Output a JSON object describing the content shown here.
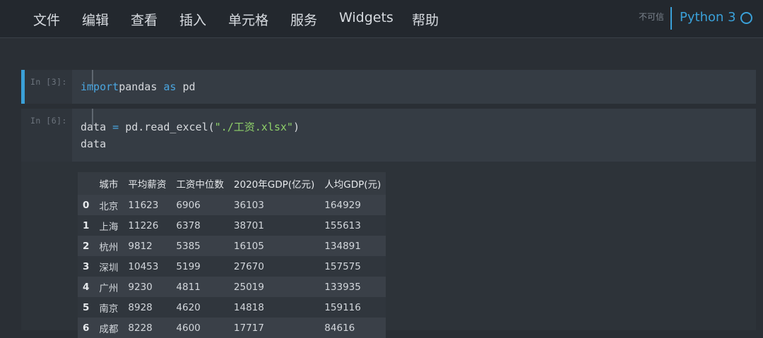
{
  "menu": [
    "文件",
    "编辑",
    "查看",
    "插入",
    "单元格",
    "服务",
    "Widgets",
    "帮助"
  ],
  "trust": "不可信",
  "kernel": "Python 3",
  "cells": [
    {
      "prompt": "In [3]:",
      "lines": [
        {
          "parts": [
            [
              "kw",
              "import"
            ],
            [
              "",
              "pandas"
            ],
            [
              "kw",
              " as"
            ],
            [
              "",
              " pd"
            ]
          ]
        }
      ]
    },
    {
      "prompt": "In [6]:",
      "lines": [
        {
          "parts": [
            [
              "",
              "data "
            ],
            [
              "eq",
              "="
            ],
            [
              "",
              " pd.read_excel("
            ],
            [
              "str",
              "\"./工资.xlsx\""
            ],
            [
              "",
              ")"
            ]
          ]
        },
        {
          "parts": [
            [
              "",
              "data"
            ]
          ]
        }
      ]
    }
  ],
  "table": {
    "columns": [
      "",
      "城市",
      "平均薪资",
      "工资中位数",
      "2020年GDP(亿元)",
      "人均GDP(元)"
    ],
    "rows": [
      [
        "0",
        "北京",
        "11623",
        "6906",
        "36103",
        "164929"
      ],
      [
        "1",
        "上海",
        "11226",
        "6378",
        "38701",
        "155613"
      ],
      [
        "2",
        "杭州",
        "9812",
        "5385",
        "16105",
        "134891"
      ],
      [
        "3",
        "深圳",
        "10453",
        "5199",
        "27670",
        "157575"
      ],
      [
        "4",
        "广州",
        "9230",
        "4811",
        "25019",
        "133935"
      ],
      [
        "5",
        "南京",
        "8928",
        "4620",
        "14818",
        "159116"
      ],
      [
        "6",
        "成都",
        "8228",
        "4600",
        "17717",
        "84616"
      ]
    ]
  }
}
